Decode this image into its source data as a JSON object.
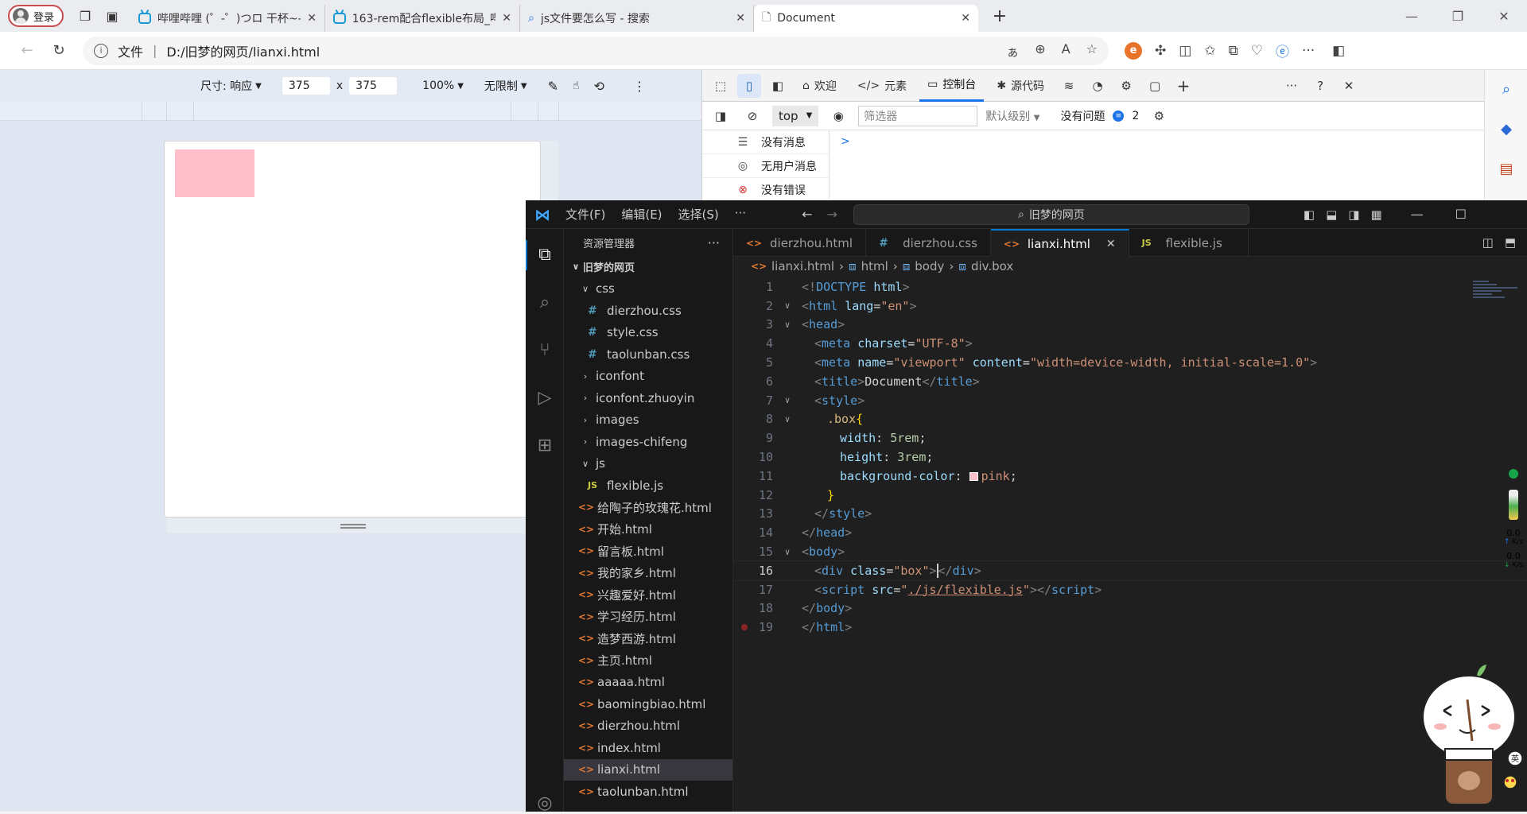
{
  "browser": {
    "profile_label": "登录",
    "tabs": [
      {
        "title": "哔哩哔哩 (゜-゜)つロ 干杯~-bilib",
        "icon": "bilibili-icon"
      },
      {
        "title": "163-rem配合flexible布局_哔哩哔",
        "icon": "bilibili-icon"
      },
      {
        "title": "js文件要怎么写 - 搜索",
        "icon": "search-icon"
      },
      {
        "title": "Document",
        "icon": "page-icon",
        "active": true
      }
    ],
    "address": {
      "scheme_label": "文件",
      "url": "D:/旧梦的网页/lianxi.html"
    }
  },
  "device_toolbar": {
    "dimension_label": "尺寸: 响应",
    "width": "375",
    "times": "x",
    "height": "375",
    "zoom": "100%",
    "throttle": "无限制"
  },
  "devtools": {
    "tabs": [
      "欢迎",
      "元素",
      "控制台",
      "源代码"
    ],
    "active_tab": "控制台",
    "context": "top",
    "filter_placeholder": "筛选器",
    "level": "默认级别",
    "issues_label": "没有问题",
    "issues_count": "2",
    "sidebar": [
      {
        "label": "没有消息",
        "icon": "list-icon"
      },
      {
        "label": "无用户消息",
        "icon": "user-icon"
      },
      {
        "label": "没有错误",
        "icon": "error-icon"
      }
    ],
    "prompt": ">"
  },
  "vscode": {
    "menu": [
      "文件(F)",
      "编辑(E)",
      "选择(S)",
      "···"
    ],
    "search_label": "旧梦的网页",
    "explorer_title": "资源管理器",
    "root_folder": "旧梦的网页",
    "tree": [
      {
        "label": "css",
        "type": "folder-open",
        "indent": 1
      },
      {
        "label": "dierzhou.css",
        "type": "css",
        "indent": 2
      },
      {
        "label": "style.css",
        "type": "css",
        "indent": 2
      },
      {
        "label": "taolunban.css",
        "type": "css",
        "indent": 2
      },
      {
        "label": "iconfont",
        "type": "folder",
        "indent": 1
      },
      {
        "label": "iconfont.zhuoyin",
        "type": "folder",
        "indent": 1
      },
      {
        "label": "images",
        "type": "folder",
        "indent": 1
      },
      {
        "label": "images-chifeng",
        "type": "folder",
        "indent": 1
      },
      {
        "label": "js",
        "type": "folder-open",
        "indent": 1
      },
      {
        "label": "flexible.js",
        "type": "js",
        "indent": 2
      },
      {
        "label": "给陶子的玫瑰花.html",
        "type": "html",
        "indent": 1
      },
      {
        "label": "开始.html",
        "type": "html",
        "indent": 1
      },
      {
        "label": "留言板.html",
        "type": "html",
        "indent": 1
      },
      {
        "label": "我的家乡.html",
        "type": "html",
        "indent": 1
      },
      {
        "label": "兴趣爱好.html",
        "type": "html",
        "indent": 1
      },
      {
        "label": "学习经历.html",
        "type": "html",
        "indent": 1
      },
      {
        "label": "造梦西游.html",
        "type": "html",
        "indent": 1
      },
      {
        "label": "主页.html",
        "type": "html",
        "indent": 1
      },
      {
        "label": "aaaaa.html",
        "type": "html",
        "indent": 1
      },
      {
        "label": "baomingbiao.html",
        "type": "html",
        "indent": 1
      },
      {
        "label": "dierzhou.html",
        "type": "html",
        "indent": 1
      },
      {
        "label": "index.html",
        "type": "html",
        "indent": 1
      },
      {
        "label": "lianxi.html",
        "type": "html",
        "indent": 1,
        "selected": true
      },
      {
        "label": "taolunban.html",
        "type": "html",
        "indent": 1
      }
    ],
    "editor_tabs": [
      {
        "label": "dierzhou.html",
        "type": "html"
      },
      {
        "label": "dierzhou.css",
        "type": "css"
      },
      {
        "label": "lianxi.html",
        "type": "html",
        "active": true
      },
      {
        "label": "flexible.js",
        "type": "js"
      }
    ],
    "breadcrumb": [
      "lianxi.html",
      "html",
      "body",
      "div.box"
    ],
    "current_line": "16",
    "line_numbers": [
      "1",
      "2",
      "3",
      "4",
      "5",
      "6",
      "7",
      "8",
      "9",
      "10",
      "11",
      "12",
      "13",
      "14",
      "15",
      "16",
      "17",
      "18",
      "19"
    ]
  },
  "netspeed": {
    "up": "0.0",
    "up_unit": "K/s",
    "down": "0.0",
    "down_unit": "K/s"
  },
  "mascot_badge": "英",
  "colors": {
    "preview_box": "#ffc0cb",
    "vscode_accent": "#0078d4",
    "devtools_accent": "#1a73e8"
  }
}
